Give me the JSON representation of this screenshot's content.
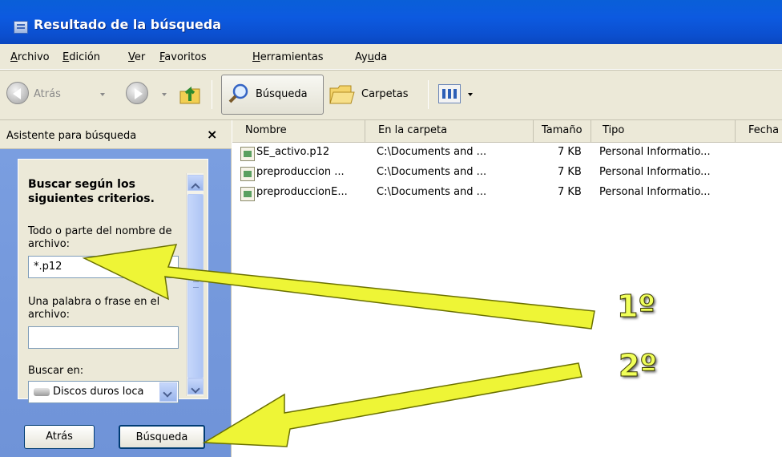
{
  "window": {
    "title": "Resultado de la búsqueda"
  },
  "menu": [
    {
      "pre": "",
      "u": "A",
      "post": "rchivo"
    },
    {
      "pre": "",
      "u": "E",
      "post": "dición"
    },
    {
      "pre": "",
      "u": "V",
      "post": "er"
    },
    {
      "pre": "",
      "u": "F",
      "post": "avoritos"
    },
    {
      "pre": "",
      "u": "H",
      "post": "erramientas"
    },
    {
      "pre": "Ay",
      "u": "u",
      "post": "da"
    }
  ],
  "toolbar": {
    "back_label": "Atrás",
    "search_label": "Búsqueda",
    "folders_label": "Carpetas"
  },
  "search_pane": {
    "header": "Asistente para búsqueda",
    "close": "×",
    "heading": "Buscar según los siguientes criterios.",
    "filename_label": "Todo o parte del nombre de archivo:",
    "filename_value": "*.p12",
    "phrase_label": "Una palabra o frase en el archivo:",
    "phrase_value": "",
    "look_in_label": "Buscar en:",
    "look_in_value": "Discos duros loca",
    "back_button": "Atrás",
    "search_button": "Búsqueda"
  },
  "results": {
    "columns": [
      "Nombre",
      "En la carpeta",
      "Tamaño",
      "Tipo",
      "Fecha"
    ],
    "rows": [
      {
        "name": "SE_activo.p12",
        "folder": "C:\\Documents and ...",
        "size": "7 KB",
        "type": "Personal Informatio..."
      },
      {
        "name": "preproduccion ...",
        "folder": "C:\\Documents and ...",
        "size": "7 KB",
        "type": "Personal Informatio..."
      },
      {
        "name": "preproduccionE...",
        "folder": "C:\\Documents and ...",
        "size": "7 KB",
        "type": "Personal Informatio..."
      }
    ]
  },
  "annotations": {
    "step1": "1º",
    "step2": "2º",
    "arrow_color": "#eef536"
  }
}
